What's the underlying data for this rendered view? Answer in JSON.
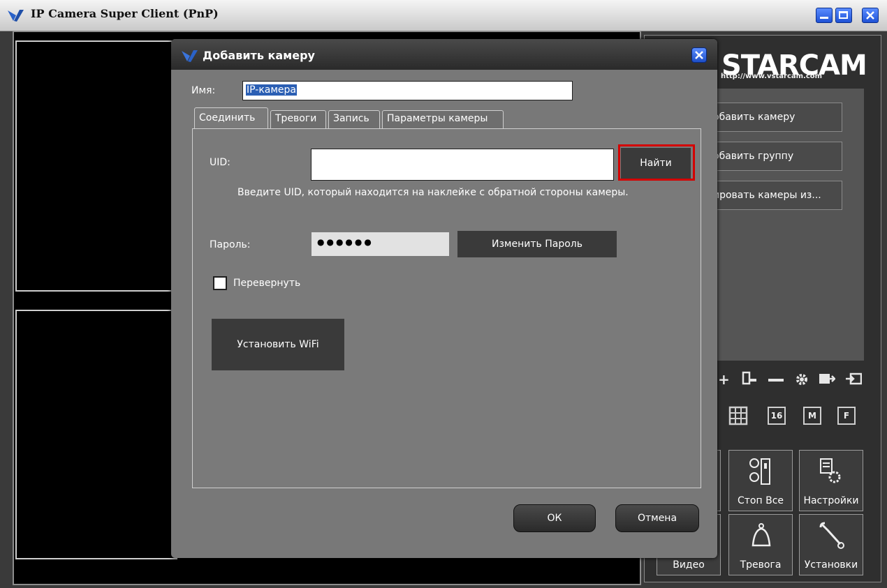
{
  "app": {
    "title": "IP Camera Super Client (PnP)"
  },
  "brand": {
    "name": "STARCAM",
    "url": "http://www.vstarcam.com"
  },
  "right_panel": {
    "buttons": [
      "обавить камеру",
      "обавить группу",
      "ировать камеры из..."
    ],
    "layout_buttons": [
      "16",
      "M",
      "F"
    ],
    "big_buttons": [
      {
        "label": "Стоп Все",
        "icon": "stop-all-icon"
      },
      {
        "label": "Настройки",
        "icon": "settings-icon"
      },
      {
        "label": "Видео",
        "icon": "video-icon"
      },
      {
        "label": "Тревога",
        "icon": "bell-icon"
      },
      {
        "label": "Установки",
        "icon": "wrench-icon"
      }
    ]
  },
  "dialog": {
    "title": "Добавить камеру",
    "name_label": "Имя:",
    "name_value": "IP-камера",
    "tabs": [
      "Соединить",
      "Тревоги",
      "Запись",
      "Параметры камеры"
    ],
    "active_tab": 0,
    "uid_label": "UID:",
    "uid_value": "",
    "find_button": "Найти",
    "uid_hint": "Введите UID, который находится на наклейке с обратной стороны камеры.",
    "password_label": "Пароль:",
    "password_mask": "●●●●●●",
    "change_password_button": "Изменить Пароль",
    "flip_label": "Перевернуть",
    "flip_checked": false,
    "wifi_button": "Установить WiFi",
    "ok_button": "ОК",
    "cancel_button": "Отмена"
  },
  "colors": {
    "highlight": "#d40000",
    "selection": "#2b5fb4",
    "dialog_bg": "#787878"
  }
}
